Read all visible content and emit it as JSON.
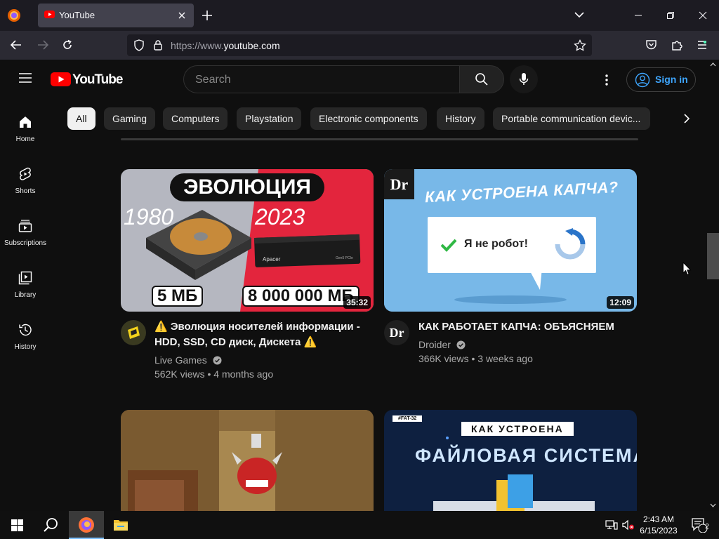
{
  "browser": {
    "tab_title": "YouTube",
    "url_prefix": "https://www.",
    "url_domain": "youtube.com"
  },
  "masthead": {
    "logo_text": "YouTube",
    "search_placeholder": "Search",
    "signin_label": "Sign in"
  },
  "sidebar": {
    "items": [
      {
        "label": "Home",
        "icon": "home-icon"
      },
      {
        "label": "Shorts",
        "icon": "shorts-icon"
      },
      {
        "label": "Subscriptions",
        "icon": "subscriptions-icon"
      },
      {
        "label": "Library",
        "icon": "library-icon"
      },
      {
        "label": "History",
        "icon": "history-icon"
      }
    ]
  },
  "chips": [
    "All",
    "Gaming",
    "Computers",
    "Playstation",
    "Electronic components",
    "History",
    "Portable communication devic..."
  ],
  "videos": [
    {
      "title": "⚠️ Эволюция носителей информации - HDD, SSD, CD диск, Дискета ⚠️",
      "channel": "Live Games",
      "stats": "562K views • 4 months ago",
      "duration": "35:32",
      "thumb_heading": "ЭВОЛЮЦИЯ",
      "thumb_year_left": "1980",
      "thumb_year_right": "2023",
      "thumb_size_left": "5 МБ",
      "thumb_size_right": "8 000 000 МБ",
      "thumb_brand": "Apacer",
      "thumb_brand_sub": "Gen5 PCIe"
    },
    {
      "title": "КАК РАБОТАЕТ КАПЧА: ОБЪЯСНЯЕМ",
      "channel": "Droider",
      "stats": "366K views • 3 weeks ago",
      "duration": "12:09",
      "avatar_text": "Dr",
      "thumb_logo": "Dr",
      "thumb_heading": "КАК УСТРОЕНА КАПЧА?",
      "thumb_captcha": "Я не робот!"
    },
    {
      "title": "",
      "channel": "",
      "stats": "",
      "duration": ""
    },
    {
      "title": "",
      "channel": "",
      "stats": "",
      "duration": "",
      "thumb_tag": "#FAT-32",
      "thumb_heading1": "КАК УСТРОЕНА",
      "thumb_heading2": "ФАЙЛОВАЯ СИСТЕМА"
    }
  ],
  "taskbar": {
    "time": "2:43 AM",
    "date": "6/15/2023",
    "notification_count": "2"
  },
  "colors": {
    "accent_red": "#ff0000",
    "link_blue": "#3ea6ff",
    "page_bg": "#0f0f0f"
  }
}
